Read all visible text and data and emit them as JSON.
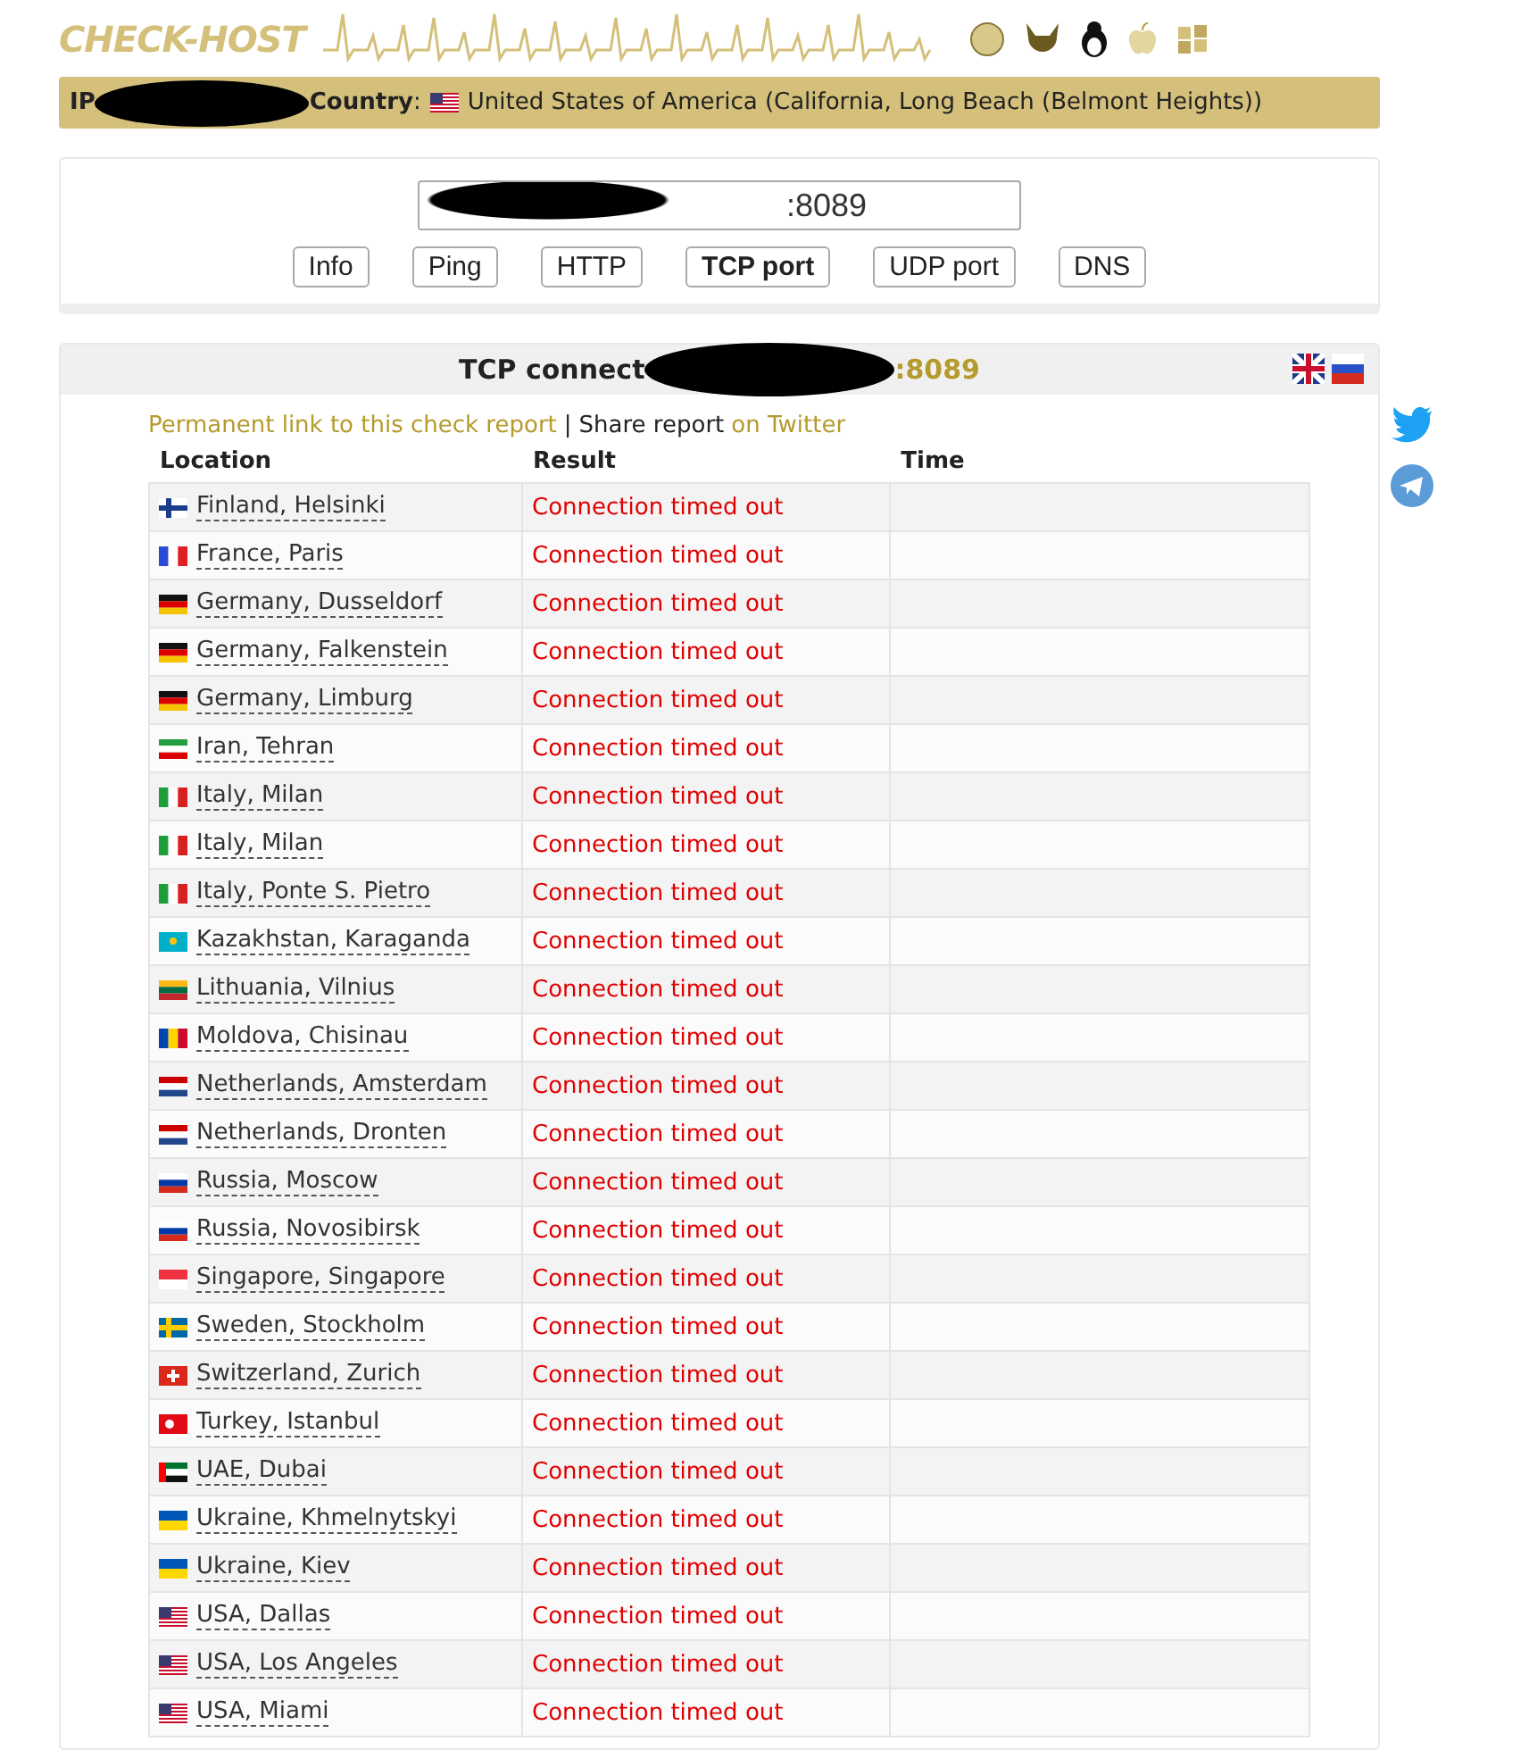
{
  "logo": {
    "text": "CHECK-HOST"
  },
  "info_bar": {
    "ip_label": "IP",
    "country_label": "Country",
    "country_separator": ":",
    "country": "United States of America (California, Long Beach (Belmont Heights))"
  },
  "host_field": {
    "value": ":8089"
  },
  "check_buttons": [
    {
      "label": "Info",
      "selected": false
    },
    {
      "label": "Ping",
      "selected": false
    },
    {
      "label": "HTTP",
      "selected": false
    },
    {
      "label": "TCP port",
      "selected": true
    },
    {
      "label": "UDP port",
      "selected": false
    },
    {
      "label": "DNS",
      "selected": false
    }
  ],
  "report": {
    "title": "TCP connect",
    "port": ":8089",
    "permanent_link": "Permanent link to this check report",
    "separator": "|",
    "share_text": "Share report",
    "share_link": "on Twitter",
    "columns": [
      "Location",
      "Result",
      "Time"
    ],
    "rows": [
      {
        "kind": "fi",
        "location": "Finland, Helsinki",
        "result": "Connection timed out"
      },
      {
        "kind": "fr",
        "location": "France, Paris",
        "result": "Connection timed out"
      },
      {
        "kind": "de",
        "location": "Germany, Dusseldorf",
        "result": "Connection timed out"
      },
      {
        "kind": "de",
        "location": "Germany, Falkenstein",
        "result": "Connection timed out"
      },
      {
        "kind": "de",
        "location": "Germany, Limburg",
        "result": "Connection timed out"
      },
      {
        "kind": "ir",
        "location": "Iran, Tehran",
        "result": "Connection timed out"
      },
      {
        "kind": "it",
        "location": "Italy, Milan",
        "result": "Connection timed out"
      },
      {
        "kind": "it",
        "location": "Italy, Milan",
        "result": "Connection timed out"
      },
      {
        "kind": "it",
        "location": "Italy, Ponte S. Pietro",
        "result": "Connection timed out"
      },
      {
        "kind": "kz",
        "location": "Kazakhstan, Karaganda",
        "result": "Connection timed out"
      },
      {
        "kind": "lt",
        "location": "Lithuania, Vilnius",
        "result": "Connection timed out"
      },
      {
        "kind": "md",
        "location": "Moldova, Chisinau",
        "result": "Connection timed out"
      },
      {
        "kind": "nl",
        "location": "Netherlands, Amsterdam",
        "result": "Connection timed out"
      },
      {
        "kind": "nl",
        "location": "Netherlands, Dronten",
        "result": "Connection timed out"
      },
      {
        "kind": "ru",
        "location": "Russia, Moscow",
        "result": "Connection timed out"
      },
      {
        "kind": "ru",
        "location": "Russia, Novosibirsk",
        "result": "Connection timed out"
      },
      {
        "kind": "sg",
        "location": "Singapore, Singapore",
        "result": "Connection timed out"
      },
      {
        "kind": "se",
        "location": "Sweden, Stockholm",
        "result": "Connection timed out"
      },
      {
        "kind": "ch",
        "location": "Switzerland, Zurich",
        "result": "Connection timed out"
      },
      {
        "kind": "tr",
        "location": "Turkey, Istanbul",
        "result": "Connection timed out"
      },
      {
        "kind": "ae",
        "location": "UAE, Dubai",
        "result": "Connection timed out"
      },
      {
        "kind": "ua",
        "location": "Ukraine, Khmelnytskyi",
        "result": "Connection timed out"
      },
      {
        "kind": "ua",
        "location": "Ukraine, Kiev",
        "result": "Connection timed out"
      },
      {
        "kind": "us",
        "location": "USA, Dallas",
        "result": "Connection timed out"
      },
      {
        "kind": "us",
        "location": "USA, Los Angeles",
        "result": "Connection timed out"
      },
      {
        "kind": "us",
        "location": "USA, Miami",
        "result": "Connection timed out"
      }
    ]
  }
}
